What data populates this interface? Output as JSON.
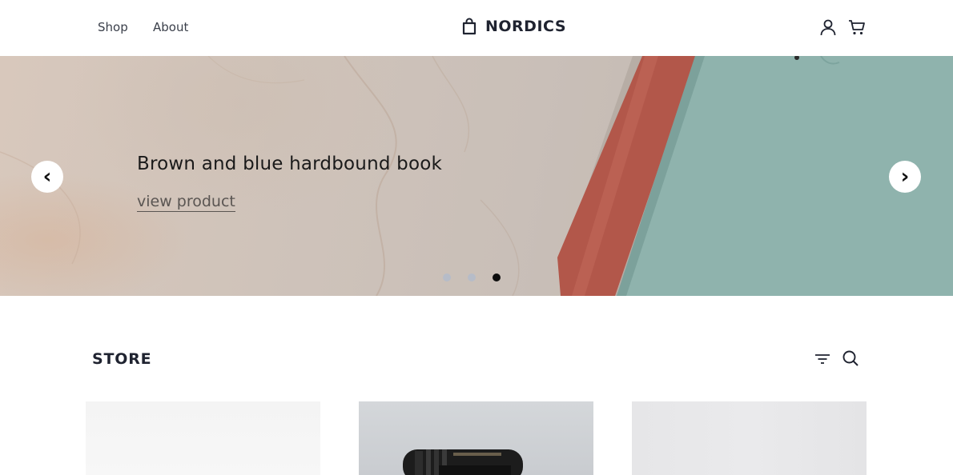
{
  "header": {
    "nav": [
      {
        "label": "Shop"
      },
      {
        "label": "About"
      }
    ],
    "brand": "NORDICS",
    "icons": [
      "shopping-bag-icon",
      "user-icon",
      "cart-icon"
    ]
  },
  "hero": {
    "title": "Brown and blue hardbound book",
    "link_label": "view product",
    "prev_glyph": "‹",
    "next_glyph": "›",
    "slides_total": 3,
    "active_slide": 3
  },
  "store": {
    "title": "STORE",
    "icons": [
      "filter-icon",
      "search-icon"
    ]
  },
  "colors": {
    "text_dark": "#1f2330",
    "dot_inactive": "#b6bcc8",
    "dot_active": "#0d0d0d",
    "book_cover": "#8fb3ad",
    "book_spine": "#b2574a"
  }
}
